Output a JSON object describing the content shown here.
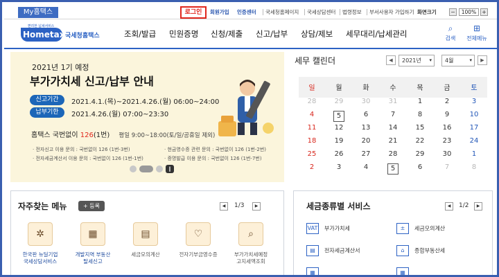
{
  "topbar": {
    "my_hometax": "My홈택스",
    "login": "로그인",
    "links": [
      "회원가입",
      "인증센터",
      "국세청홈페이지",
      "국세상담센터",
      "법령정보",
      "부서사용자 가입하기"
    ],
    "font_size_label": "화면크기",
    "zoom_minus": "−",
    "zoom_value": "100%",
    "zoom_plus": "+"
  },
  "nav": {
    "logo_small": "편리한 납세서비스",
    "logo_main": "Hometax,",
    "logo_name": "국세청홈택스",
    "menu": [
      "조회/발급",
      "민원증명",
      "신청/제출",
      "신고/납부",
      "상담/제보",
      "세무대리/납세관리"
    ],
    "search_label": "검색",
    "allmenu_label": "전체메뉴",
    "search_icon": "search-icon",
    "allmenu_icon": "grid-menu-icon"
  },
  "banner": {
    "eyebrow": "2021년 1기 예정",
    "title": "부가가치세 신고/납부 안내",
    "period_label": "신고기간",
    "period_value": "2021.4.1.(목)~2021.4.26.(월) 06:00~24:00",
    "deadline_label": "납부기한",
    "deadline_value": "2021.4.26.(월) 07:00~23:30",
    "callcenter_prefix": "홈택스 국번없이 ",
    "callcenter_number": "126",
    "callcenter_suffix": "(1번)",
    "callcenter_hours": "평일 9:00~18:00(토/일/공휴일 제외)",
    "tips": [
      "· 전자신고 이용 문의 : 국번없이 126 (1번-3번)",
      "· 전자세금계산서 이용 문의 : 국번없이 126 (1번-1번)",
      "· 현금영수증 관련 문의 : 국번없이 126 (1번-2번)",
      "· 증명발급 이용 문의 : 국번없이 126 (1번-7번)"
    ]
  },
  "calendar": {
    "title": "세무 캘린더",
    "year": "2021년",
    "month": "4월",
    "weekdays": [
      "일",
      "월",
      "화",
      "수",
      "목",
      "금",
      "토"
    ],
    "today": 5,
    "weeks": [
      [
        28,
        29,
        30,
        31,
        1,
        2,
        3
      ],
      [
        4,
        5,
        6,
        7,
        8,
        9,
        10
      ],
      [
        11,
        12,
        13,
        14,
        15,
        16,
        17
      ],
      [
        18,
        19,
        20,
        21,
        22,
        23,
        24
      ],
      [
        25,
        26,
        27,
        28,
        29,
        30,
        1
      ],
      [
        2,
        3,
        4,
        5,
        6,
        7,
        8
      ]
    ],
    "current_month_range": [
      [
        0,
        4
      ],
      [
        5,
        4
      ]
    ],
    "colors": {
      "sunday": "#d8261c",
      "saturday": "#2055b7",
      "other_month": "#b8b8b8"
    }
  },
  "quickmenu": {
    "title": "자주찾는 메뉴",
    "register": "+ 등록",
    "page": "1/3",
    "items": [
      {
        "label1": "한국판 뉴딜기업",
        "label2": "국세상담서비스",
        "icon": "newdeal-icon",
        "glyph": "✲"
      },
      {
        "label1": "개발지역 부동산",
        "label2": "탈세신고",
        "icon": "building-report-icon",
        "glyph": "▦"
      },
      {
        "label1": "세금모의계산",
        "label2": "",
        "icon": "calculator-icon",
        "glyph": "▤"
      },
      {
        "label1": "전자기부금영수증",
        "label2": "",
        "icon": "donation-receipt-icon",
        "glyph": "♡"
      },
      {
        "label1": "부가가치세예정",
        "label2": "고지세액조회",
        "icon": "vat-lookup-icon",
        "glyph": "⌕"
      }
    ]
  },
  "taxservice": {
    "title": "세금종류별 서비스",
    "page": "1/2",
    "items": [
      {
        "label": "부가가치세",
        "icon": "vat-icon",
        "glyph": "VAT"
      },
      {
        "label": "세금모의계산",
        "icon": "calculator-icon",
        "glyph": "±"
      },
      {
        "label": "전자세금계산서",
        "icon": "e-invoice-icon",
        "glyph": "▤"
      },
      {
        "label": "종합부동산세",
        "icon": "property-tax-icon",
        "glyph": "⌂"
      },
      {
        "label": "",
        "icon": "more-service-icon",
        "glyph": "▦"
      },
      {
        "label": "",
        "icon": "more-service-icon",
        "glyph": "▦"
      }
    ]
  }
}
